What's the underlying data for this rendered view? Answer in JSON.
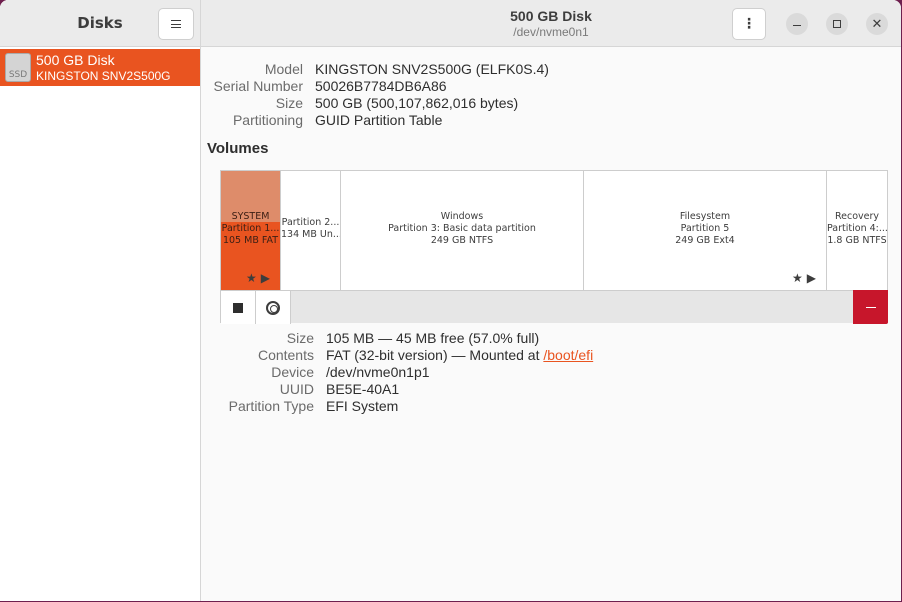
{
  "sidebar": {
    "title": "Disks",
    "disks": [
      {
        "name": "500 GB Disk",
        "model": "KINGSTON SNV2S500G",
        "icon_label": "SSD"
      }
    ]
  },
  "header": {
    "title": "500 GB Disk",
    "subtitle": "/dev/nvme0n1",
    "menu_icon": "⋮",
    "close_icon": "✕"
  },
  "drive": {
    "model_label": "Model",
    "model": "KINGSTON SNV2S500G (ELFK0S.4)",
    "serial_label": "Serial Number",
    "serial": "50026B7784DB6A86",
    "size_label": "Size",
    "size": "500 GB (500,107,862,016 bytes)",
    "partitioning_label": "Partitioning",
    "partitioning": "GUID Partition Table"
  },
  "volumes": {
    "title": "Volumes",
    "partitions": [
      {
        "line1": "SYSTEM",
        "line2": "Partition 1...",
        "line3": "105 MB FAT",
        "selected": true
      },
      {
        "line1": "",
        "line2": "Partition 2...",
        "line3": "134 MB Un...",
        "selected": false
      },
      {
        "line1": "Windows",
        "line2": "Partition 3: Basic data partition",
        "line3": "249 GB NTFS",
        "selected": false
      },
      {
        "line1": "Filesystem",
        "line2": "Partition 5",
        "line3": "249 GB Ext4",
        "selected": false
      },
      {
        "line1": "Recovery",
        "line2": "Partition 4:...",
        "line3": "1.8 GB NTFS",
        "selected": false
      }
    ],
    "free_fraction_selected": 0.43
  },
  "selected_partition": {
    "size_label": "Size",
    "size": "105 MB — 45 MB free (57.0% full)",
    "contents_label": "Contents",
    "contents_prefix": "FAT (32-bit version) — Mounted at ",
    "mount_point": "/boot/efi",
    "device_label": "Device",
    "device": "/dev/nvme0n1p1",
    "uuid_label": "UUID",
    "uuid": "BE5E-40A1",
    "ptype_label": "Partition Type",
    "ptype": "EFI System"
  }
}
